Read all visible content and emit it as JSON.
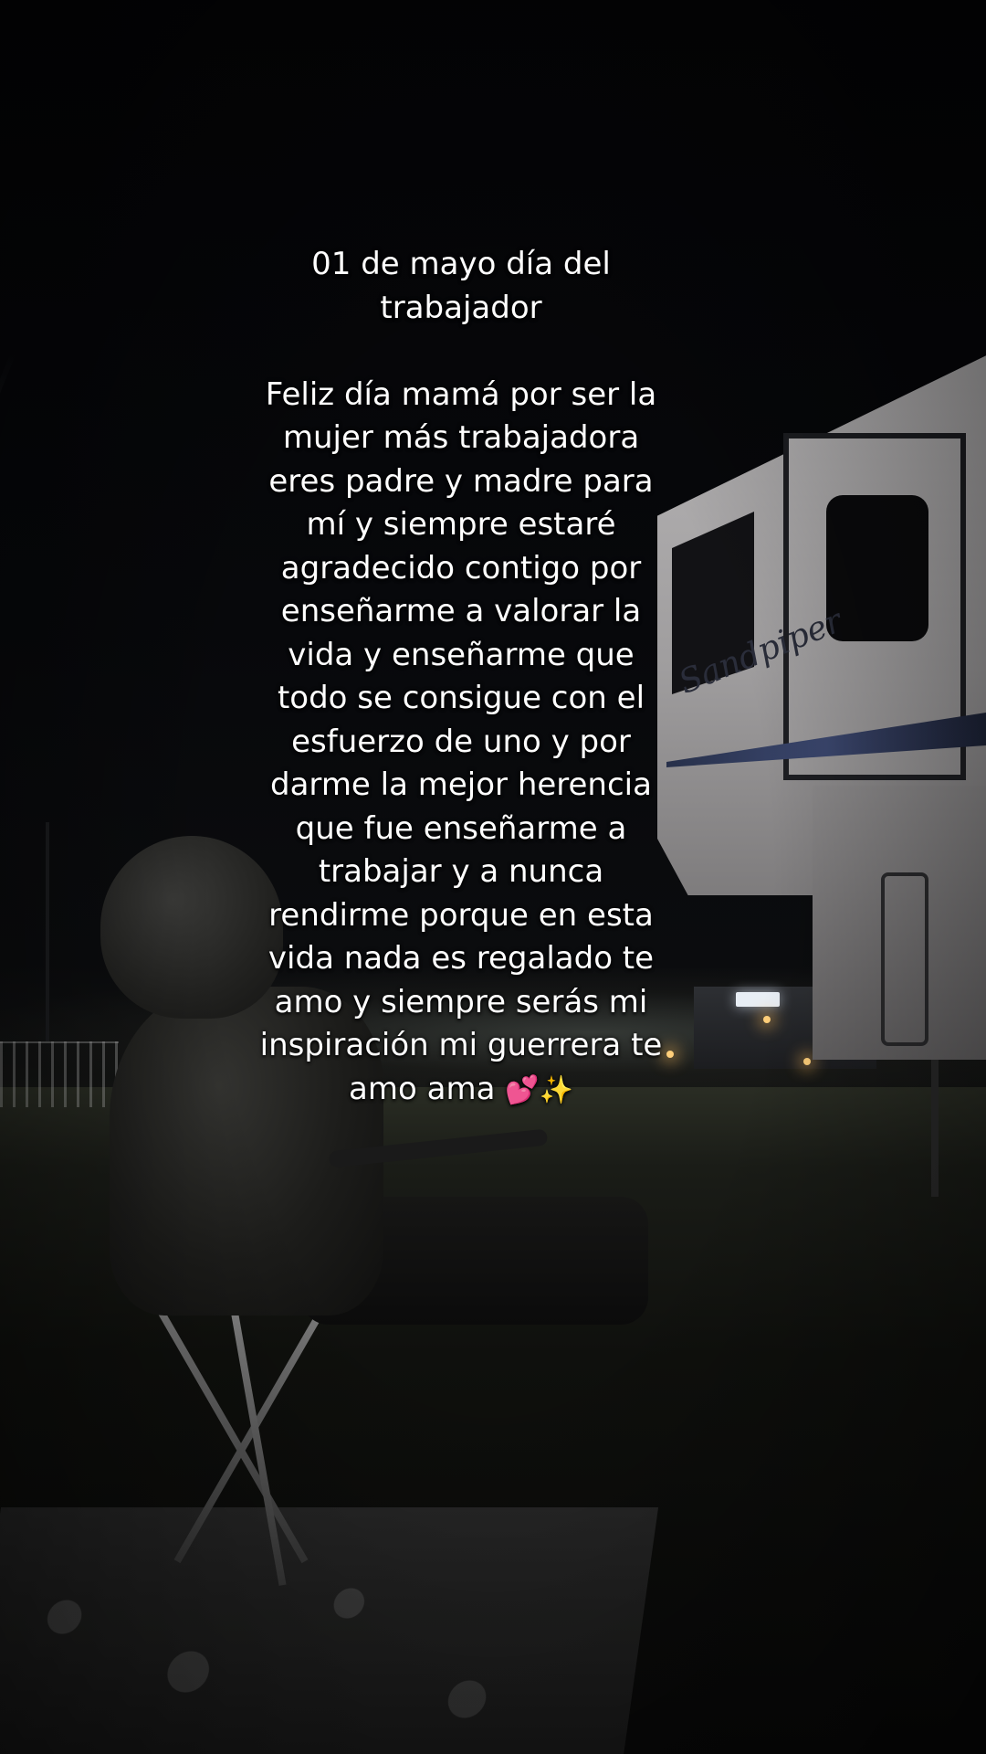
{
  "caption": {
    "title": "01 de mayo día del\ntrabajador",
    "body": "Feliz día mamá por ser la\nmujer más trabajadora\neres padre y madre para\nmí y siempre estaré\nagradecido contigo por\nenseñarme a valorar la\nvida y enseñarme que\ntodo se consigue con el\nesfuerzo de uno y por\ndarme la mejor herencia\nque fue enseñarme a\ntrabajar y a nunca\nrendirme porque en esta\nvida nada es regalado te\namo y siempre serás mi\ninspiración mi guerrera te\namo ama",
    "emojis": [
      "💕",
      "✨"
    ]
  },
  "scene": {
    "rv_logo": "Sandpiper"
  },
  "icons": {
    "hearts": "two-hearts-icon",
    "sparkles": "sparkles-icon"
  },
  "colors": {
    "caption_text": "#ffffff",
    "hearts": "#ff4fa8",
    "sparkles": "#ffd84a"
  }
}
